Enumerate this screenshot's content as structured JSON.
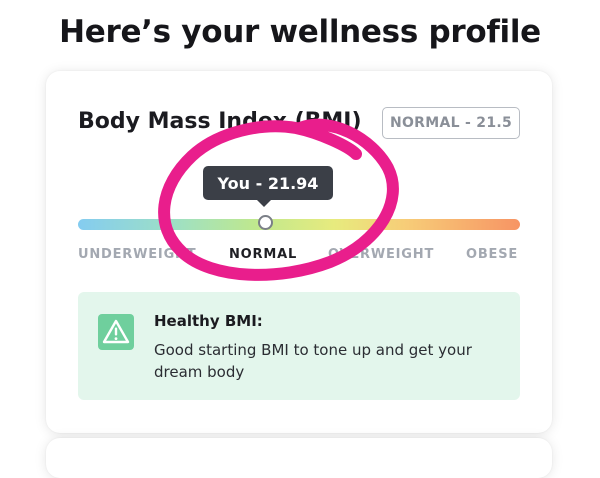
{
  "page": {
    "title": "Here’s your wellness profile"
  },
  "bmi_card": {
    "heading": "Body Mass Index (BMI)",
    "status_badge": "NORMAL - 21.5",
    "tooltip": "You - 21.94",
    "scale_labels": [
      "UNDERWEIGHT",
      "NORMAL",
      "OVERWEIGHT",
      "OBESE"
    ],
    "active_category": "NORMAL",
    "info": {
      "title": "Healthy BMI:",
      "body": "Good starting BMI to tone up and get your dream body"
    }
  },
  "colors": {
    "annotation_circle": "#e91e8c",
    "info_background": "#e3f6ec",
    "tooltip_background": "#3b3f47"
  },
  "icons": {
    "warning": "warning-triangle-icon"
  }
}
